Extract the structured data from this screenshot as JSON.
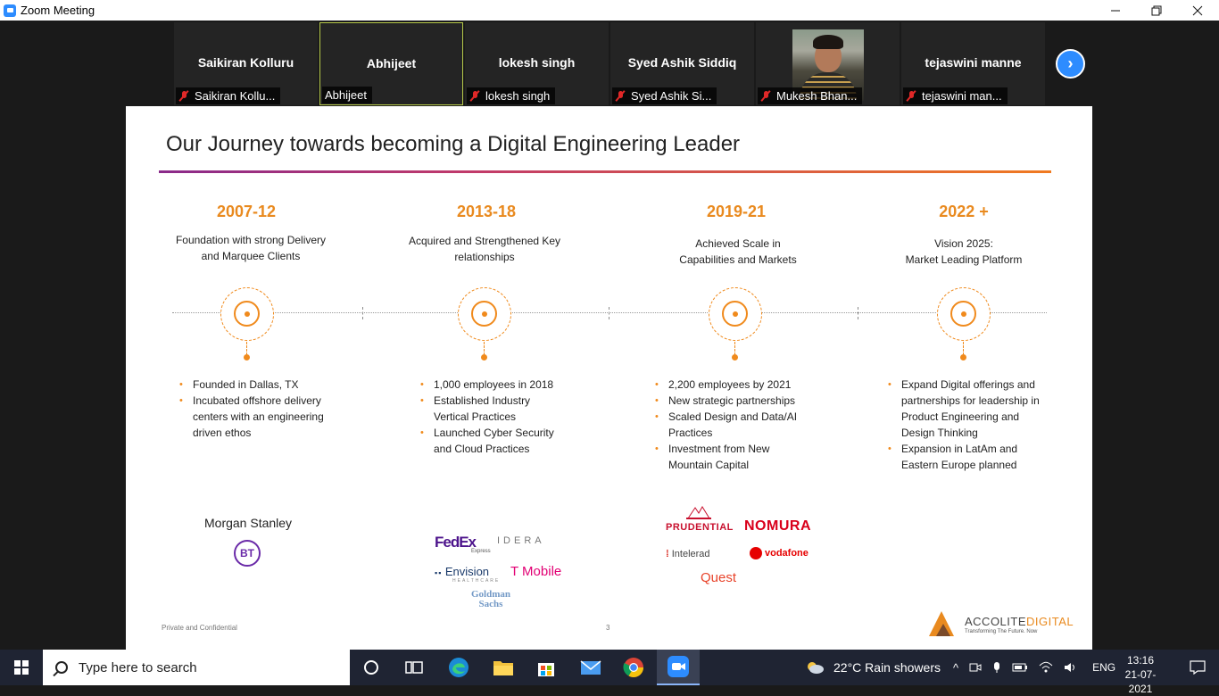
{
  "window": {
    "title": "Zoom Meeting"
  },
  "participants": [
    {
      "display_name": "Saikiran Kolluru",
      "label": "Saikiran Kollu...",
      "muted": true,
      "active": false
    },
    {
      "display_name": "Abhijeet",
      "label": "Abhijeet",
      "muted": false,
      "active": true
    },
    {
      "display_name": "lokesh singh",
      "label": "lokesh singh",
      "muted": true,
      "active": false
    },
    {
      "display_name": "Syed Ashik Siddiq",
      "label": "Syed Ashik Si...",
      "muted": true,
      "active": false
    },
    {
      "display_name": "",
      "label": "Mukesh Bhan...",
      "muted": true,
      "active": false,
      "video": true
    },
    {
      "display_name": "tejaswini manne",
      "label": "tejaswini man...",
      "muted": true,
      "active": false
    }
  ],
  "slide": {
    "title": "Our Journey towards becoming a Digital Engineering Leader",
    "columns": [
      {
        "period": "2007-12",
        "desc1": "Foundation with strong Delivery",
        "desc2": "and Marquee Clients",
        "bullets": [
          "Founded in Dallas, TX",
          "Incubated offshore delivery centers with an engineering driven ethos"
        ],
        "logos": [
          "Morgan Stanley",
          "BT"
        ]
      },
      {
        "period": "2013-18",
        "desc1": "Acquired and Strengthened Key",
        "desc2": "relationships",
        "bullets": [
          "1,000 employees in 2018",
          "Established Industry Vertical Practices",
          "Launched Cyber Security and Cloud Practices"
        ],
        "logos": [
          "FedEx",
          "Express",
          "IDERA",
          "Envision",
          "HEALTHCARE",
          "T Mobile",
          "Goldman",
          "Sachs"
        ]
      },
      {
        "period": "2019-21",
        "desc1": "Achieved Scale in",
        "desc2": "Capabilities and Markets",
        "bullets": [
          "2,200 employees by 2021",
          "New strategic partnerships",
          "Scaled Design and Data/AI Practices",
          "Investment from New Mountain Capital"
        ],
        "logos": [
          "PRUDENTIAL",
          "NOMURA",
          "Intelerad",
          "vodafone",
          "Quest"
        ]
      },
      {
        "period": "2022 +",
        "desc1": "Vision 2025:",
        "desc2": "Market Leading Platform",
        "bullets": [
          "Expand Digital offerings and partnerships for leadership in Product Engineering and Design Thinking",
          "Expansion in LatAm and Eastern Europe planned"
        ],
        "logos": []
      }
    ],
    "footer_left": "Private and Confidential",
    "page_number": "3",
    "brand_a": "ACCOLITE",
    "brand_b": "DIGITAL",
    "brand_tagline": "Transforming The Future. Now"
  },
  "taskbar": {
    "search_placeholder": "Type here to search",
    "weather": "22°C  Rain showers",
    "language": "ENG",
    "time": "13:16",
    "date": "21-07-2021"
  },
  "colors": {
    "accent": "#e98a1f",
    "zoom_blue": "#2d8cff",
    "taskbar": "#1f2433"
  }
}
